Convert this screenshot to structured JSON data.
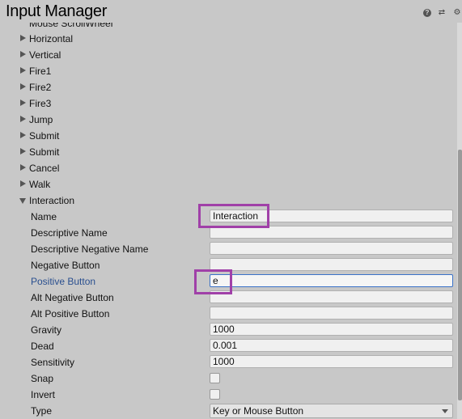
{
  "window": {
    "title": "Input Manager"
  },
  "axes": [
    "Mouse ScrollWheel",
    "Horizontal",
    "Vertical",
    "Fire1",
    "Fire2",
    "Fire3",
    "Jump",
    "Submit",
    "Submit",
    "Cancel",
    "Walk"
  ],
  "expanded_axis": "Interaction",
  "properties": {
    "name": {
      "label": "Name",
      "value": "Interaction"
    },
    "descriptive_name": {
      "label": "Descriptive Name",
      "value": ""
    },
    "descriptive_negative_name": {
      "label": "Descriptive Negative Name",
      "value": ""
    },
    "negative_button": {
      "label": "Negative Button",
      "value": ""
    },
    "positive_button": {
      "label": "Positive Button",
      "value": "e"
    },
    "alt_negative_button": {
      "label": "Alt Negative Button",
      "value": ""
    },
    "alt_positive_button": {
      "label": "Alt Positive Button",
      "value": ""
    },
    "gravity": {
      "label": "Gravity",
      "value": "1000"
    },
    "dead": {
      "label": "Dead",
      "value": "0.001"
    },
    "sensitivity": {
      "label": "Sensitivity",
      "value": "1000"
    },
    "snap": {
      "label": "Snap"
    },
    "invert": {
      "label": "Invert"
    },
    "type": {
      "label": "Type",
      "value": "Key or Mouse Button"
    }
  },
  "colors": {
    "highlight": "#a040a8",
    "active_label": "#2a4f8f",
    "background": "#c8c8c8"
  },
  "icons": [
    "help-icon",
    "preset-icon",
    "gear-icon",
    "foldout-arrow-icon",
    "dropdown-caret-icon"
  ]
}
